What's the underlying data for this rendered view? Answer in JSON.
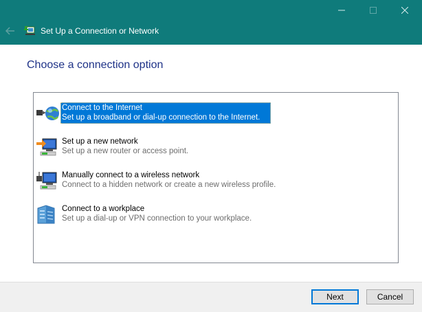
{
  "window": {
    "title": "Set Up a Connection or Network",
    "titlebar_color": "#0f7b7b"
  },
  "page": {
    "heading": "Choose a connection option"
  },
  "options": [
    {
      "title": "Connect to the Internet",
      "description": "Set up a broadband or dial-up connection to the Internet.",
      "icon": "globe-network-icon",
      "selected": true
    },
    {
      "title": "Set up a new network",
      "description": "Set up a new router or access point.",
      "icon": "new-network-icon",
      "selected": false
    },
    {
      "title": "Manually connect to a wireless network",
      "description": "Connect to a hidden network or create a new wireless profile.",
      "icon": "wireless-network-icon",
      "selected": false
    },
    {
      "title": "Connect to a workplace",
      "description": "Set up a dial-up or VPN connection to your workplace.",
      "icon": "workplace-building-icon",
      "selected": false
    }
  ],
  "buttons": {
    "next": "Next",
    "cancel": "Cancel"
  },
  "colors": {
    "selection": "#0078d7",
    "heading": "#1e3287"
  }
}
